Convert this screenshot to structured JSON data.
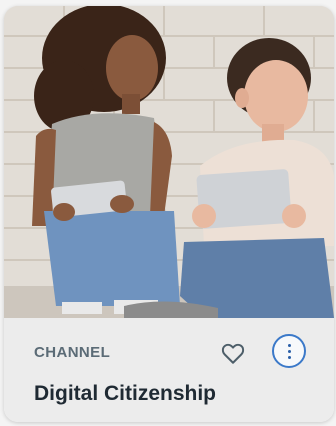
{
  "card": {
    "kind_label": "CHANNEL",
    "title": "Digital Citizenship",
    "thumbnail_icon": "photo-two-kids-with-tablets",
    "favorite_icon": "heart-outline-icon",
    "more_icon": "vertical-ellipsis-icon",
    "accent_color": "#3b79c9"
  }
}
